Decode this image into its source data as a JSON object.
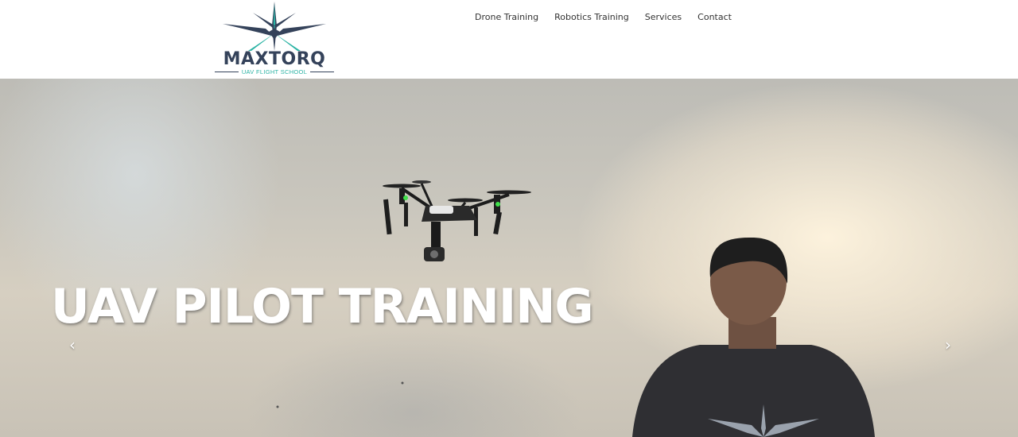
{
  "brand": {
    "name": "MAXTORQ",
    "tagline": "UAV FLIGHT SCHOOL",
    "colors": {
      "navy": "#34425a",
      "teal": "#2bb3a4"
    }
  },
  "nav": {
    "items": [
      {
        "label": "Drone Training"
      },
      {
        "label": "Robotics Training"
      },
      {
        "label": "Services"
      },
      {
        "label": "Contact"
      }
    ]
  },
  "hero": {
    "title": "UAV PILOT TRAINING",
    "prev_icon": "chevron-left-icon",
    "next_icon": "chevron-right-icon",
    "prev_glyph": "‹",
    "next_glyph": "›"
  }
}
